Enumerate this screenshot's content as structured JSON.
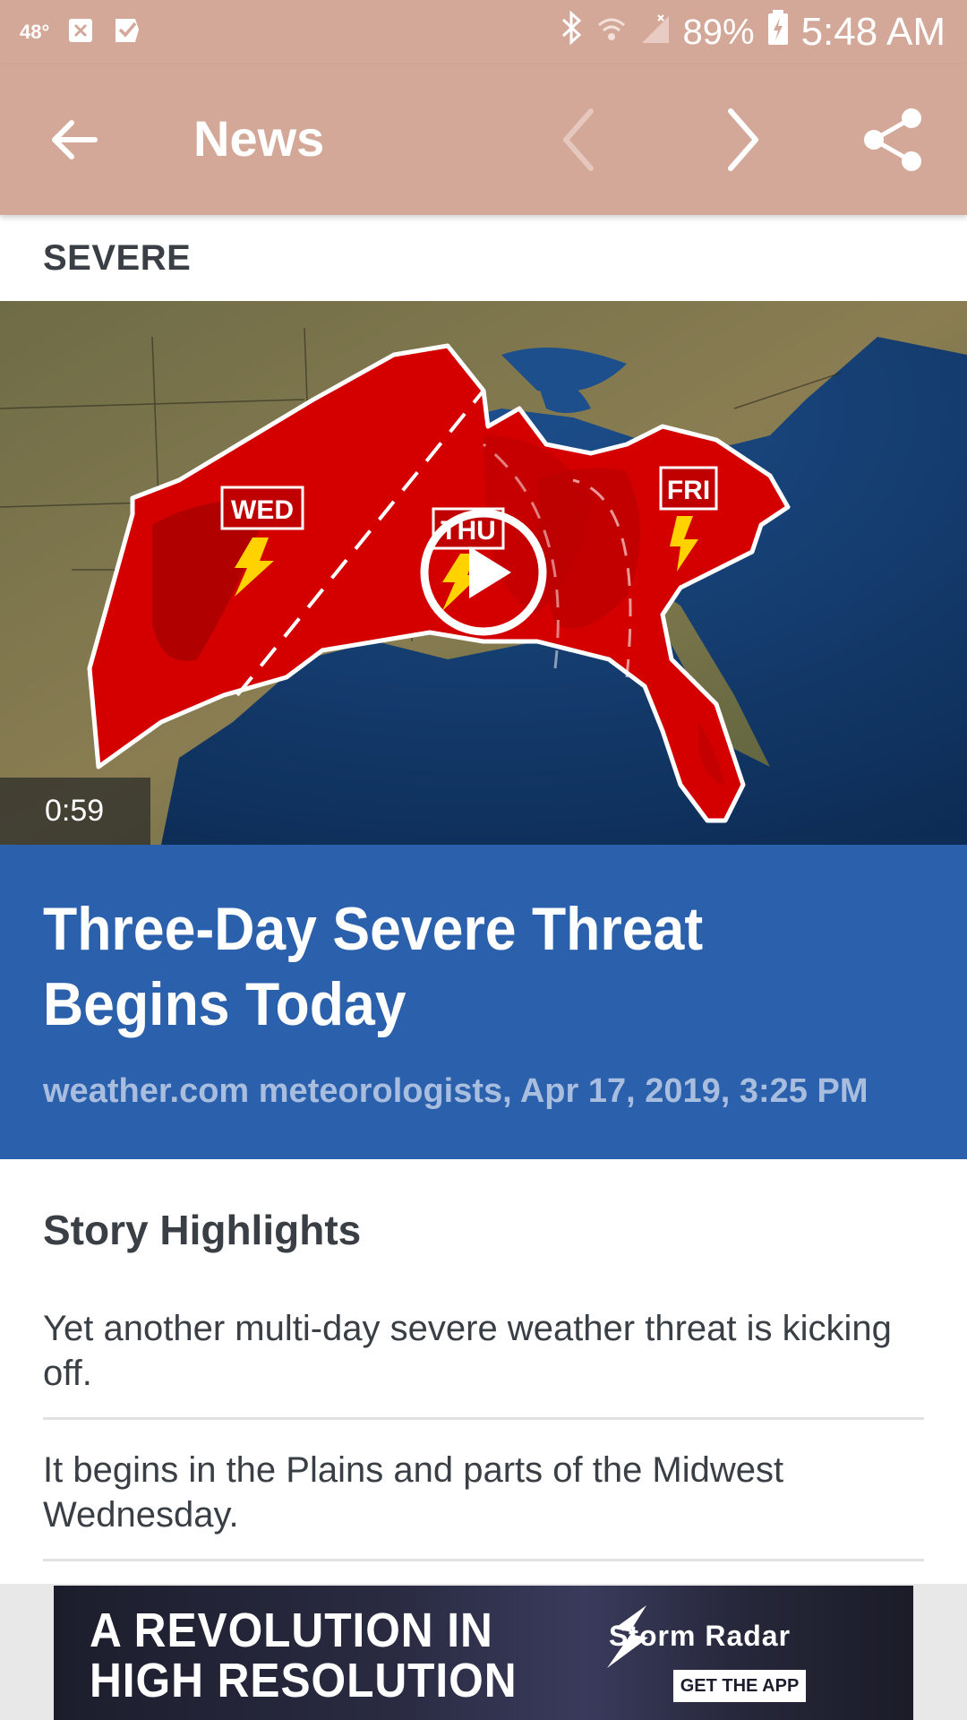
{
  "status_bar": {
    "temperature": "48°",
    "battery": "89%",
    "time": "5:48 AM"
  },
  "app_bar": {
    "title": "News"
  },
  "article": {
    "category": "SEVERE",
    "video": {
      "duration": "0:59",
      "map_labels": [
        "WED",
        "THU",
        "FRI"
      ]
    },
    "headline": "Three-Day Severe Threat Begins Today",
    "byline": "weather.com meteorologists, Apr 17, 2019, 3:25 PM"
  },
  "story_highlights": {
    "title": "Story Highlights",
    "items": [
      "Yet another multi-day severe weather threat is kicking off.",
      "It begins in the Plains and parts of the Midwest Wednesday."
    ]
  },
  "ad": {
    "headline_line1": "A REVOLUTION IN",
    "headline_line2": "HIGH RESOLUTION",
    "brand": "Storm Radar",
    "cta": "GET THE APP"
  },
  "colors": {
    "app_bar": "#d4a899",
    "headline_block": "#2b61ac",
    "byline": "#a9bedf",
    "threat_red": "#d40000"
  }
}
